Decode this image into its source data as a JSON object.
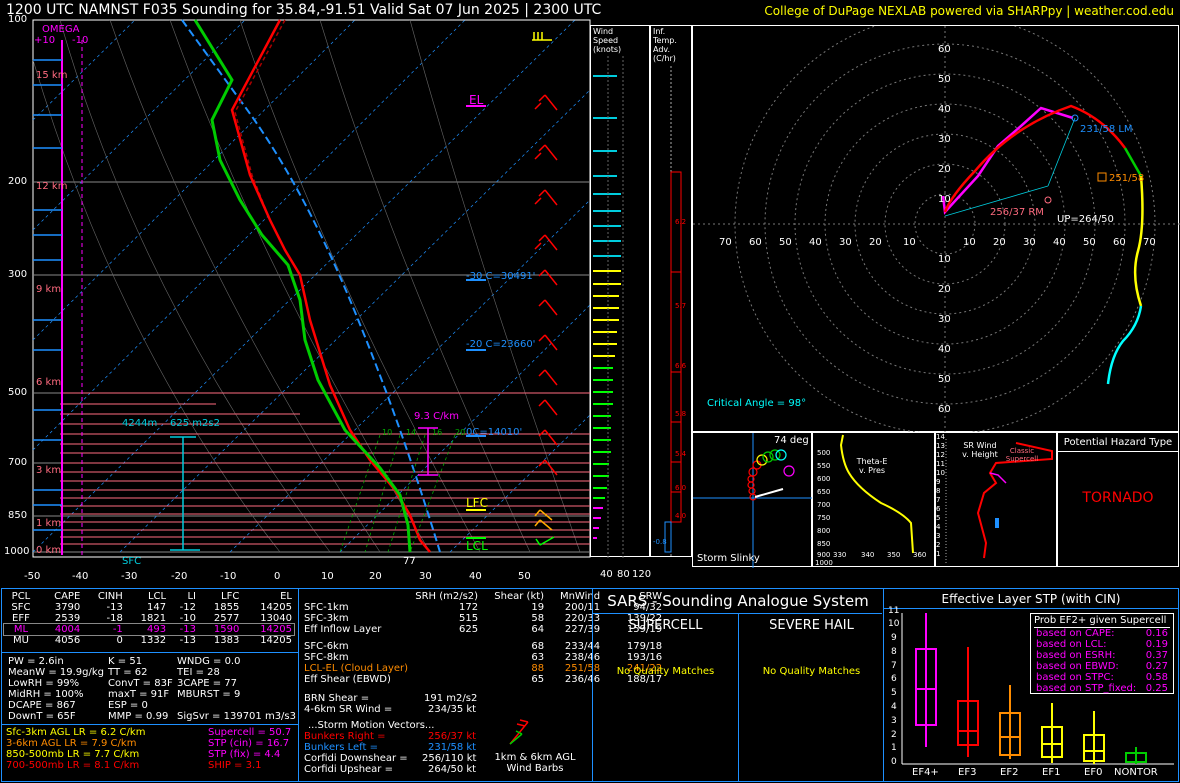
{
  "header": {
    "title": "1200 UTC NAMNST F035 Sounding for 35.84,-91.51 Valid  Sat 07 Jun 2025 | 2300 UTC",
    "credit": "College of DuPage NEXLAB powered via SHARPpy | weather.cod.edu"
  },
  "skewt": {
    "pressure_labels": [
      "100",
      "200",
      "300",
      "500",
      "700",
      "850",
      "1000"
    ],
    "temp_labels": [
      "-50",
      "-40",
      "-30",
      "-20",
      "-10",
      "0",
      "10",
      "20",
      "30",
      "40",
      "50"
    ],
    "omega_label": "OMEGA",
    "omega_scale": [
      "+10",
      "-10"
    ],
    "height_labels": [
      "15 km",
      "12 km",
      "9 km",
      "6 km",
      "3 km",
      "1 km",
      "0 km"
    ],
    "el_label": "EL",
    "lfc_label": "LFC",
    "lcl_label": "LCL",
    "sfc_label": "SFC",
    "iso30": "-30 C=30491'",
    "iso20": "-20 C=23660'",
    "iso0": "0C=14010'",
    "lapse_label": "9.3 C/km",
    "eff_inflow_depth": "4244m",
    "eff_inflow_srh": "625 m2s2",
    "sfc_temp": "77",
    "mixing_labels": [
      "10",
      "14",
      "16",
      "20"
    ]
  },
  "wind_speed_panel": {
    "title": "Wind Speed (knots)",
    "scale": [
      "40",
      "80",
      "120"
    ]
  },
  "temp_adv_panel": {
    "title": "Inf. Temp. Adv. (C/hr)",
    "values": [
      "6.2",
      "5.7",
      "6.6",
      "5.8",
      "5.4",
      "6.0",
      "4.0",
      "-0.8"
    ]
  },
  "hodograph": {
    "rings": [
      "60",
      "50",
      "40",
      "30",
      "20",
      "10"
    ],
    "x_labels": [
      "70",
      "60",
      "50",
      "40",
      "30",
      "20",
      "10",
      "10",
      "20",
      "30",
      "40",
      "50",
      "60",
      "70"
    ],
    "lm": "231/58 LM",
    "mean": "251/58",
    "rm": "256/37 RM",
    "up": "UP=264/50",
    "critical_angle": "Critical Angle = 98°"
  },
  "storm_slinky": {
    "label": "Storm Slinky",
    "angle": "74 deg"
  },
  "theta_e": {
    "title": "Theta-E v. Pres",
    "pres": [
      "500",
      "550",
      "600",
      "650",
      "700",
      "750",
      "800",
      "850",
      "900",
      "950"
    ],
    "x": [
      "330",
      "340",
      "350",
      "360"
    ],
    "bottom": "1000"
  },
  "srwind": {
    "title": "SR Wind v. Height",
    "heights": [
      "14",
      "13",
      "12",
      "11",
      "10",
      "9",
      "8",
      "7",
      "6",
      "5",
      "4",
      "3",
      "2",
      "1"
    ],
    "classic": "Classic Supercell"
  },
  "hazard": {
    "title": "Potential Hazard Type",
    "value": "TORNADO"
  },
  "parcels": {
    "headers": [
      "PCL",
      "CAPE",
      "CINH",
      "LCL",
      "LI",
      "LFC",
      "EL"
    ],
    "rows": [
      [
        "SFC",
        "3790",
        "-13",
        "147",
        "-12",
        "1855",
        "14205"
      ],
      [
        "EFF",
        "2539",
        "-18",
        "1821",
        "-10",
        "2577",
        "13040"
      ],
      [
        "ML",
        "4004",
        "-1",
        "493",
        "-13",
        "1590",
        "14205"
      ],
      [
        "MU",
        "4056",
        "0",
        "1332",
        "-13",
        "1383",
        "14205"
      ]
    ]
  },
  "indices": [
    [
      "PW = 2.6in",
      "K = 51",
      "WNDG = 0.0"
    ],
    [
      "MeanW = 19.9g/kg",
      "TT = 62",
      "TEI = 28"
    ],
    [
      "LowRH = 99%",
      "ConvT = 83F",
      "3CAPE = 77"
    ],
    [
      "MidRH = 100%",
      "maxT = 91F",
      "MBURST = 9"
    ],
    [
      "DCAPE = 867",
      "ESP = 0",
      ""
    ],
    [
      "DownT = 65F",
      "MMP = 0.99",
      "SigSvr = 139701 m3/s3"
    ]
  ],
  "lapse_rates": [
    {
      "text": "Sfc-3km AGL LR = 6.2 C/km",
      "color": "#ffff00"
    },
    {
      "text": "3-6km AGL LR = 7.9 C/km",
      "color": "#ff8c00"
    },
    {
      "text": "850-500mb LR = 7.7 C/km",
      "color": "#ffff00"
    },
    {
      "text": "700-500mb LR = 8.1 C/km",
      "color": "#ff0000"
    }
  ],
  "composites": [
    {
      "text": "Supercell = 50.7",
      "color": "#ff00ff"
    },
    {
      "text": "STP (cin) = 16.7",
      "color": "#ff00ff"
    },
    {
      "text": "STP (fix) = 4.4",
      "color": "#ff00ff"
    },
    {
      "text": "SHIP = 3.1",
      "color": "#ff0000"
    }
  ],
  "kinematics": {
    "headers": [
      "SRH (m2/s2)",
      "Shear (kt)",
      "MnWind",
      "SRW"
    ],
    "rows": [
      {
        "label": "SFC-1km",
        "srh": "172",
        "shear": "19",
        "mn": "200/11",
        "srw": "94/32",
        "color": "#fff"
      },
      {
        "label": "SFC-3km",
        "srh": "515",
        "shear": "58",
        "mn": "220/33",
        "srw": "139/22",
        "color": "#fff"
      },
      {
        "label": "Eff Inflow Layer",
        "srh": "625",
        "shear": "64",
        "mn": "227/39",
        "srw": "159/19",
        "color": "#fff"
      },
      {
        "label": "",
        "srh": "",
        "shear": "",
        "mn": "",
        "srw": "",
        "color": "#fff"
      },
      {
        "label": "SFC-6km",
        "srh": "",
        "shear": "68",
        "mn": "233/44",
        "srw": "179/18",
        "color": "#fff"
      },
      {
        "label": "SFC-8km",
        "srh": "",
        "shear": "63",
        "mn": "238/46",
        "srw": "193/16",
        "color": "#fff"
      },
      {
        "label": "LCL-EL (Cloud Layer)",
        "srh": "",
        "shear": "88",
        "mn": "251/58",
        "srw": "241/22",
        "color": "#ff8c00"
      },
      {
        "label": "Eff Shear (EBWD)",
        "srh": "",
        "shear": "65",
        "mn": "236/46",
        "srw": "188/17",
        "color": "#fff"
      }
    ],
    "brn_shear": "BRN Shear =",
    "brn_val": "191 m2/s2",
    "sr_wind": "4-6km SR Wind =",
    "sr_val": "234/35 kt",
    "motion_title": "...Storm Motion Vectors...",
    "motions": [
      {
        "label": "Bunkers Right =",
        "val": "256/37 kt",
        "color": "#ff0000"
      },
      {
        "label": "Bunkers Left =",
        "val": "231/58 kt",
        "color": "#1e90ff"
      },
      {
        "label": "Corfidi Downshear =",
        "val": "256/110 kt",
        "color": "#fff"
      },
      {
        "label": "Corfidi Upshear =",
        "val": "264/50 kt",
        "color": "#fff"
      }
    ],
    "barb_caption": "1km & 6km AGL Wind Barbs"
  },
  "sars": {
    "title": "SARS - Sounding Analogue System",
    "supercell": "SUPERCELL",
    "hail": "SEVERE HAIL",
    "nomatch1": "No Quality Matches",
    "nomatch2": "No Quality Matches"
  },
  "stp": {
    "title": "Effective Layer STP (with CIN)",
    "prob_title": "Prob EF2+ given Supercell",
    "probs": [
      {
        "label": "based on CAPE:",
        "val": "0.16"
      },
      {
        "label": "based on LCL:",
        "val": "0.19"
      },
      {
        "label": "based on ESRH:",
        "val": "0.37"
      },
      {
        "label": "based on EBWD:",
        "val": "0.27"
      },
      {
        "label": "based on STPC:",
        "val": "0.58"
      },
      {
        "label": "based on STP_fixed:",
        "val": "0.25"
      }
    ],
    "y_labels": [
      "11",
      "10",
      "9",
      "8",
      "7",
      "6",
      "5",
      "4",
      "3",
      "2",
      "1",
      "0"
    ],
    "categories": [
      "EF4+",
      "EF3",
      "EF2",
      "EF1",
      "EF0",
      "NONTOR"
    ]
  }
}
